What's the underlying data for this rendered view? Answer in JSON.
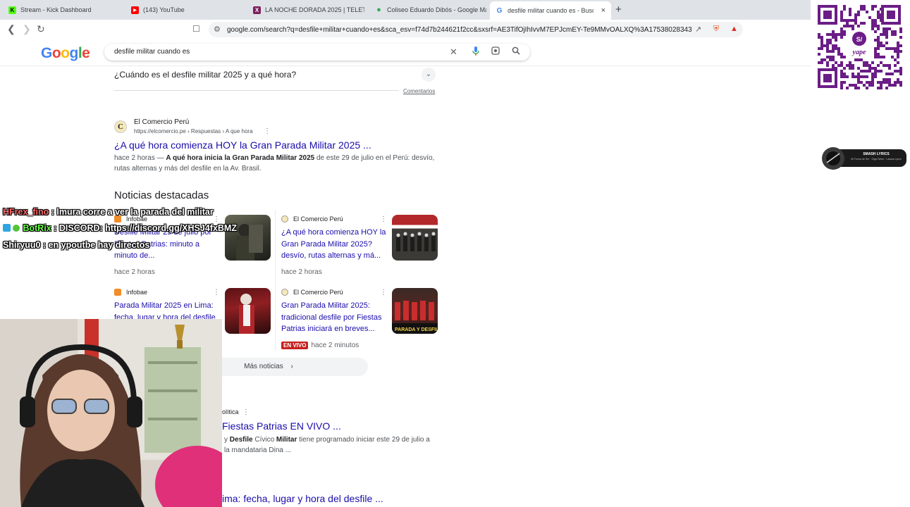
{
  "browser": {
    "tabs": [
      {
        "title": "Stream - Kick Dashboard",
        "icon": "kick-icon",
        "color": "#53fc18",
        "glyph": "K"
      },
      {
        "title": "(143) YouTube",
        "icon": "youtube-icon",
        "color": "#ff0000",
        "glyph": "▶"
      },
      {
        "title": "LA NOCHE DORADA 2025 | TELETICK",
        "icon": "teleticket-icon",
        "color": "#7a1f5c",
        "glyph": "X"
      },
      {
        "title": "Coliseo Eduardo Dibós - Google Map",
        "icon": "maps-pin-icon",
        "color": "#34a853",
        "glyph": "●"
      },
      {
        "title": "desfile militar cuando es - Busca",
        "icon": "google-g-icon",
        "color": "#4285f4",
        "glyph": "G"
      }
    ],
    "new_tab": "+",
    "close_tab": "×",
    "url": "google.com/search?q=desfile+militar+cuando+es&sca_esv=f74d7b244621f2cc&sxsrf=AE3TifOjIhIvvM7EPJcmEY-Te9MMvOALXQ%3A17538028343..."
  },
  "google": {
    "logo": "Google",
    "query": "desfile militar cuando es"
  },
  "faq": {
    "question": "¿Cuándo es el desfile militar 2025 y a qué hora?",
    "feedback_link": "Comentarios"
  },
  "result1": {
    "site_name": "El Comercio Perú",
    "site_url": "https://elcomercio.pe › Respuestas › A que hora",
    "title": "¿A qué hora comienza HOY la Gran Parada Militar 2025 ...",
    "snippet_pre": "hace 2 horas — ",
    "snippet_bold1": "A qué hora inicia la Gran Parada Militar 2025",
    "snippet_mid": " de este 29 de julio en el Perú: desvío, rutas alternas y más del desfile en la Av. Brasil."
  },
  "top_stories": {
    "heading": "Noticias destacadas",
    "items": [
      {
        "source": "Infobae",
        "title": "Desfile Militar 29 de julio por Fiestas Patrias: minuto a minuto de...",
        "time": "hace 2 horas"
      },
      {
        "source": "El Comercio Perú",
        "title": "¿A qué hora comienza HOY la Gran Parada Militar 2025? desvío, rutas alternas y má...",
        "time": "hace 2 horas"
      },
      {
        "source": "Infobae",
        "title": "Parada Militar 2025 en Lima: fecha, lugar y hora del desfile",
        "time": ""
      },
      {
        "source": "El Comercio Perú",
        "title": "Gran Parada Militar 2025: tradicional desfile por Fiestas Patrias iniciará en breves...",
        "time": "hace 2 minutos",
        "live": "EN VIVO"
      }
    ],
    "more": "Más noticias"
  },
  "result2": {
    "source_fragment": "olítica",
    "title_fragment": "Fiestas Patrias EN VIVO ...",
    "snippet_a": "y ",
    "snippet_b1": "Desfile",
    "snippet_c": " Cívico ",
    "snippet_b2": "Militar",
    "snippet_d": " tiene programado iniciar este 29 de julio a",
    "snippet_line2": "la mandataria Dina ..."
  },
  "result3": {
    "title_fragment": "ima: fecha, lugar y hora del desfile ..."
  },
  "chat": [
    {
      "user": "HFrex_fino",
      "message": " : lmura corre a ver la parada del militar"
    },
    {
      "user": "BotRix",
      "message": " : DISCORD: https://discord.gg/XHSJ4fxBMZ"
    },
    {
      "user": "Shiryuu0",
      "message": " : en ypoutbe hay directos"
    }
  ],
  "overlay": {
    "qr_label": "yape",
    "music_title": "SMASH LYRICS",
    "music_sub": "Mi Forma de Ser · Olga Tañon · Lakasa Lyrics"
  }
}
